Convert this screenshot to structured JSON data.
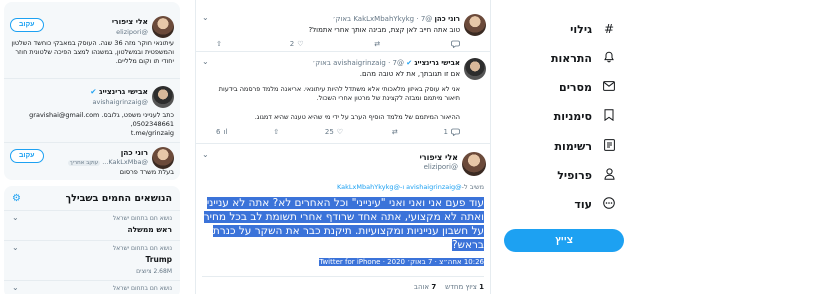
{
  "nav": {
    "items": [
      {
        "label": "גילוי",
        "icon": "hashtag-icon"
      },
      {
        "label": "התראות",
        "icon": "bell-icon"
      },
      {
        "label": "מסרים",
        "icon": "envelope-icon"
      },
      {
        "label": "סימניות",
        "icon": "bookmark-icon"
      },
      {
        "label": "רשימות",
        "icon": "list-icon"
      },
      {
        "label": "פרופיל",
        "icon": "person-icon"
      },
      {
        "label": "עוד",
        "icon": "more-icon"
      }
    ],
    "tweet_button": "צייץ",
    "accent": "#1da1f2"
  },
  "timeline": {
    "tweets": [
      {
        "name": "רוני כהן",
        "handle": "@KakLxMbahYkykg",
        "time": "7 באוק׳",
        "text": "טוב אתה חייב לאן קצת, מבינה אותך אחרי אתמול?",
        "reply": "",
        "retweet": "",
        "like": "2"
      },
      {
        "name": "אבישי גרינצייג",
        "handle": "@avishaigrinzaig",
        "time": "7 באוק׳",
        "text1": "אם זו תגובתך, את לא טובה מהם.",
        "text2": "אני לא עוסק באיזון מלאכותי אלא משתדל להיות עיתונאי. אריאנה מלמד פרסמה בידעות תיאור מיתמם ומבזה לקצינת של מרטון אחרי השכול.",
        "text3": "ההיאור המיתמם של מלמד הוסיף הערב על ידי מי שהיא טענה שהיא דמגוג.",
        "reply": "1",
        "retweet": "",
        "like": "25",
        "views": "6"
      }
    ],
    "main_tweet": {
      "name": "אלי ציפורי",
      "handle": "@elizipori",
      "reply_to_prefix": "משיב ל-",
      "reply_to": "@avishaigrinzaig ו-@KakLxMbahYkykg",
      "text": "עוד פעם אני ואני ואני \"עינייני\" וכל האחרים לא? אתה לא ענייני ואתה לא מקצועי, אתה אחד שרודף אחרי תשומת לב בכל מחיר על חשבון ענייניות ומקצועיות. תיקנת כבר את השקר על כנרת בראש?",
      "meta": "10:26 אחה״צ · 7 באוק׳ 2020 · Twitter for iPhone",
      "retweets_count": "1",
      "retweets_label": "ציוץ מחדש",
      "likes_count": "7",
      "likes_label": "אוהב"
    }
  },
  "sidebar": {
    "people": [
      {
        "name": "אלי ציפורי",
        "handle": "@elizipori",
        "follow": "עקוב",
        "bio": "עיתונאי חוקר מזה 36 שנה. העוסק במאבקי כוחשד השלטון והמשפטית ובמשלטון, במשנהו למצב הפיכה שלטונית חוזר יחודי תו וקום מלליים."
      },
      {
        "name": "אבישי גרינצייג",
        "handle": "@avishaigrinzaig",
        "bio": "כתב לענייני משפט, גלובס. gravishai@gmail.com ,0502348661",
        "link": "t.me/grinzaig"
      },
      {
        "name": "רוני כהן",
        "handle": "@KakLxMba...",
        "follows_you": "עוקב אחריך",
        "follow": "עקוב",
        "bio": "בעלת משרד פרסום"
      }
    ],
    "trends_title": "הנושאים החמים בשבילך",
    "trends": [
      {
        "category": "נושא חם בתחום ישראל",
        "name": "ראש ממשלה",
        "count": ""
      },
      {
        "category": "נושא חם בתחום ישראל",
        "name": "Trump",
        "count": "2.68M ציוצים"
      },
      {
        "category": "נושא חם בתחום ישראל",
        "name": "",
        "count": ""
      }
    ]
  }
}
